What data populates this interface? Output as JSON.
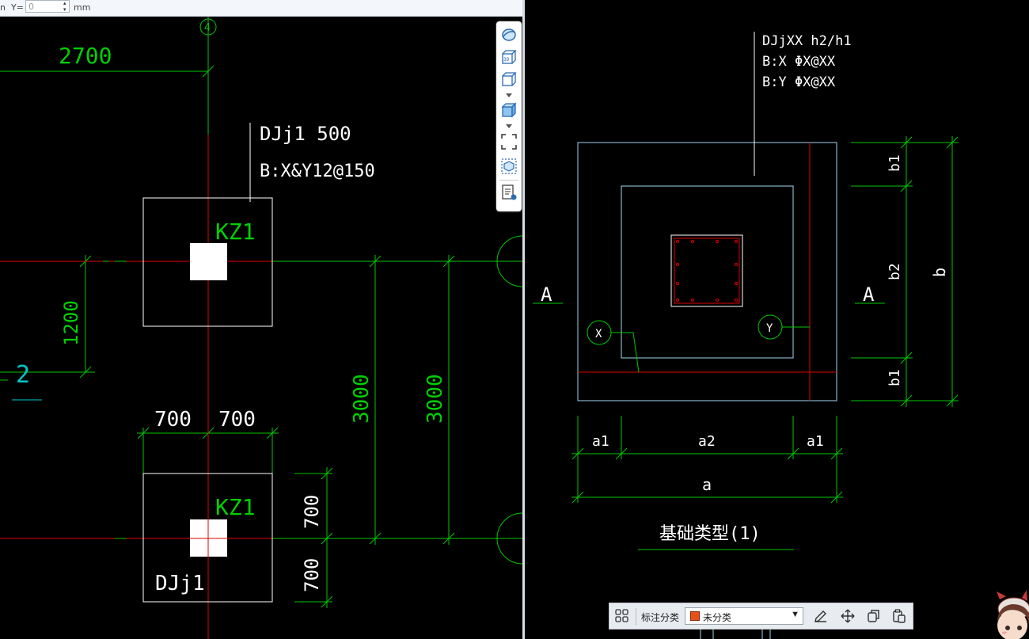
{
  "coord_bar": {
    "prefix": "n",
    "y_label": "Y=",
    "y_value": "0",
    "unit": "mm"
  },
  "left_drawing": {
    "axis_bubble": "4",
    "dim_top": "2700",
    "dim_vert_left": "1200",
    "dim_vert_mid1": "3000",
    "dim_vert_mid2": "3000",
    "dim_700_left": "700",
    "dim_700_right": "700",
    "dim_700_v_top": "700",
    "dim_700_v_bottom": "700",
    "section_mark": "2",
    "leader_line1": "DJj1 500",
    "leader_line2": "B:X&Y12@150",
    "column_label_top": "KZ1",
    "column_label_bottom": "KZ1",
    "footing_label": "DJj1"
  },
  "right_drawing": {
    "leader_line1": "DJjXX h2/h1",
    "leader_line2": "B:X  ΦX@XX",
    "leader_line3": "B:Y  ΦX@XX",
    "section_left": "A",
    "section_right": "A",
    "bubble_x": "X",
    "bubble_y": "Y",
    "dim_b1_top": "b1",
    "dim_b2": "b2",
    "dim_b1_bottom": "b1",
    "dim_b": "b",
    "dim_a1_left": "a1",
    "dim_a2": "a2",
    "dim_a1_right": "a1",
    "dim_a": "a",
    "caption": "基础类型(1)"
  },
  "view_toolbar": {
    "icons": [
      "orbit-icon",
      "3d-view-icon",
      "cube-front-icon",
      "cube-solid-icon",
      "fullscreen-icon",
      "view-box-icon",
      "layer-display-icon"
    ]
  },
  "annotation_bar": {
    "label": "标注分类",
    "selected": "未分类",
    "swatch_color": "#e8501a"
  },
  "colors": {
    "grid_line": "#00c800",
    "axis_red": "#e00000",
    "outline_blue": "#9fd6ef",
    "outline_white": "#ffffff",
    "dim_text_green": "#00d000",
    "cyan_text": "#00c8c8"
  }
}
